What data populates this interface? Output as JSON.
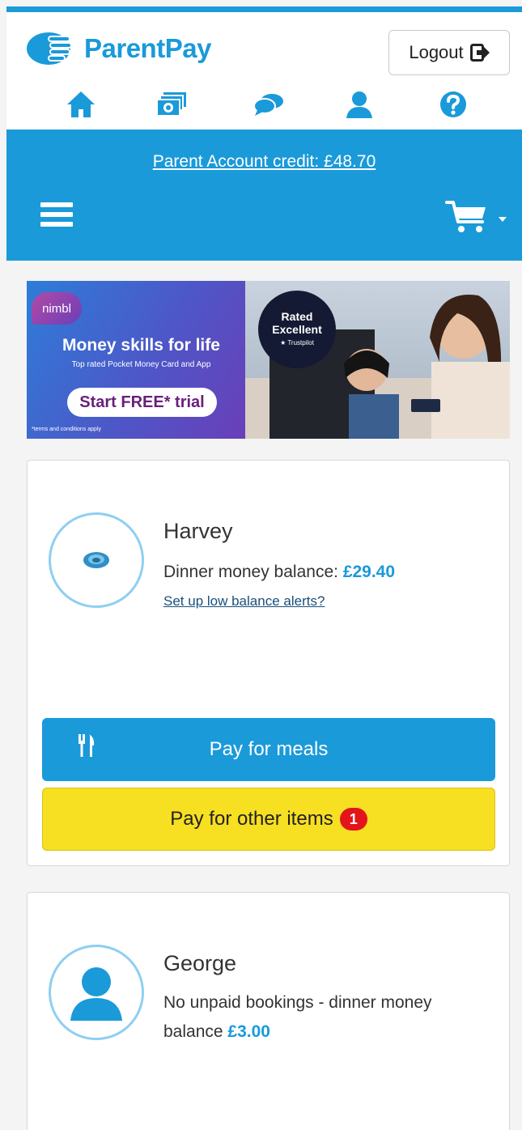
{
  "brand": {
    "name": "ParentPay",
    "color": "#1a9ad9"
  },
  "header": {
    "logout_label": "Logout"
  },
  "nav_icons": [
    {
      "name": "home-icon"
    },
    {
      "name": "payments-icon"
    },
    {
      "name": "messages-icon"
    },
    {
      "name": "profile-icon"
    },
    {
      "name": "help-icon"
    }
  ],
  "account": {
    "credit_text": "Parent Account credit: £48.70"
  },
  "banner": {
    "logo_text": "nimbl",
    "headline": "Money skills for life",
    "subline": "Top rated Pocket Money Card and App",
    "cta": "Start FREE* trial",
    "terms": "*terms and conditions apply",
    "rated_line1": "Rated",
    "rated_line2": "Excellent",
    "rated_source": "★ Trustpilot"
  },
  "children": [
    {
      "name": "Harvey",
      "balance_label": "Dinner money balance:",
      "balance": "£29.40",
      "alerts_link": "Set up low balance alerts?",
      "pay_meals_label": "Pay for meals",
      "pay_other_label": "Pay for other items",
      "other_badge": "1"
    },
    {
      "name": "George",
      "balance_label": "No unpaid bookings - dinner money balance",
      "balance": "£3.00"
    }
  ]
}
